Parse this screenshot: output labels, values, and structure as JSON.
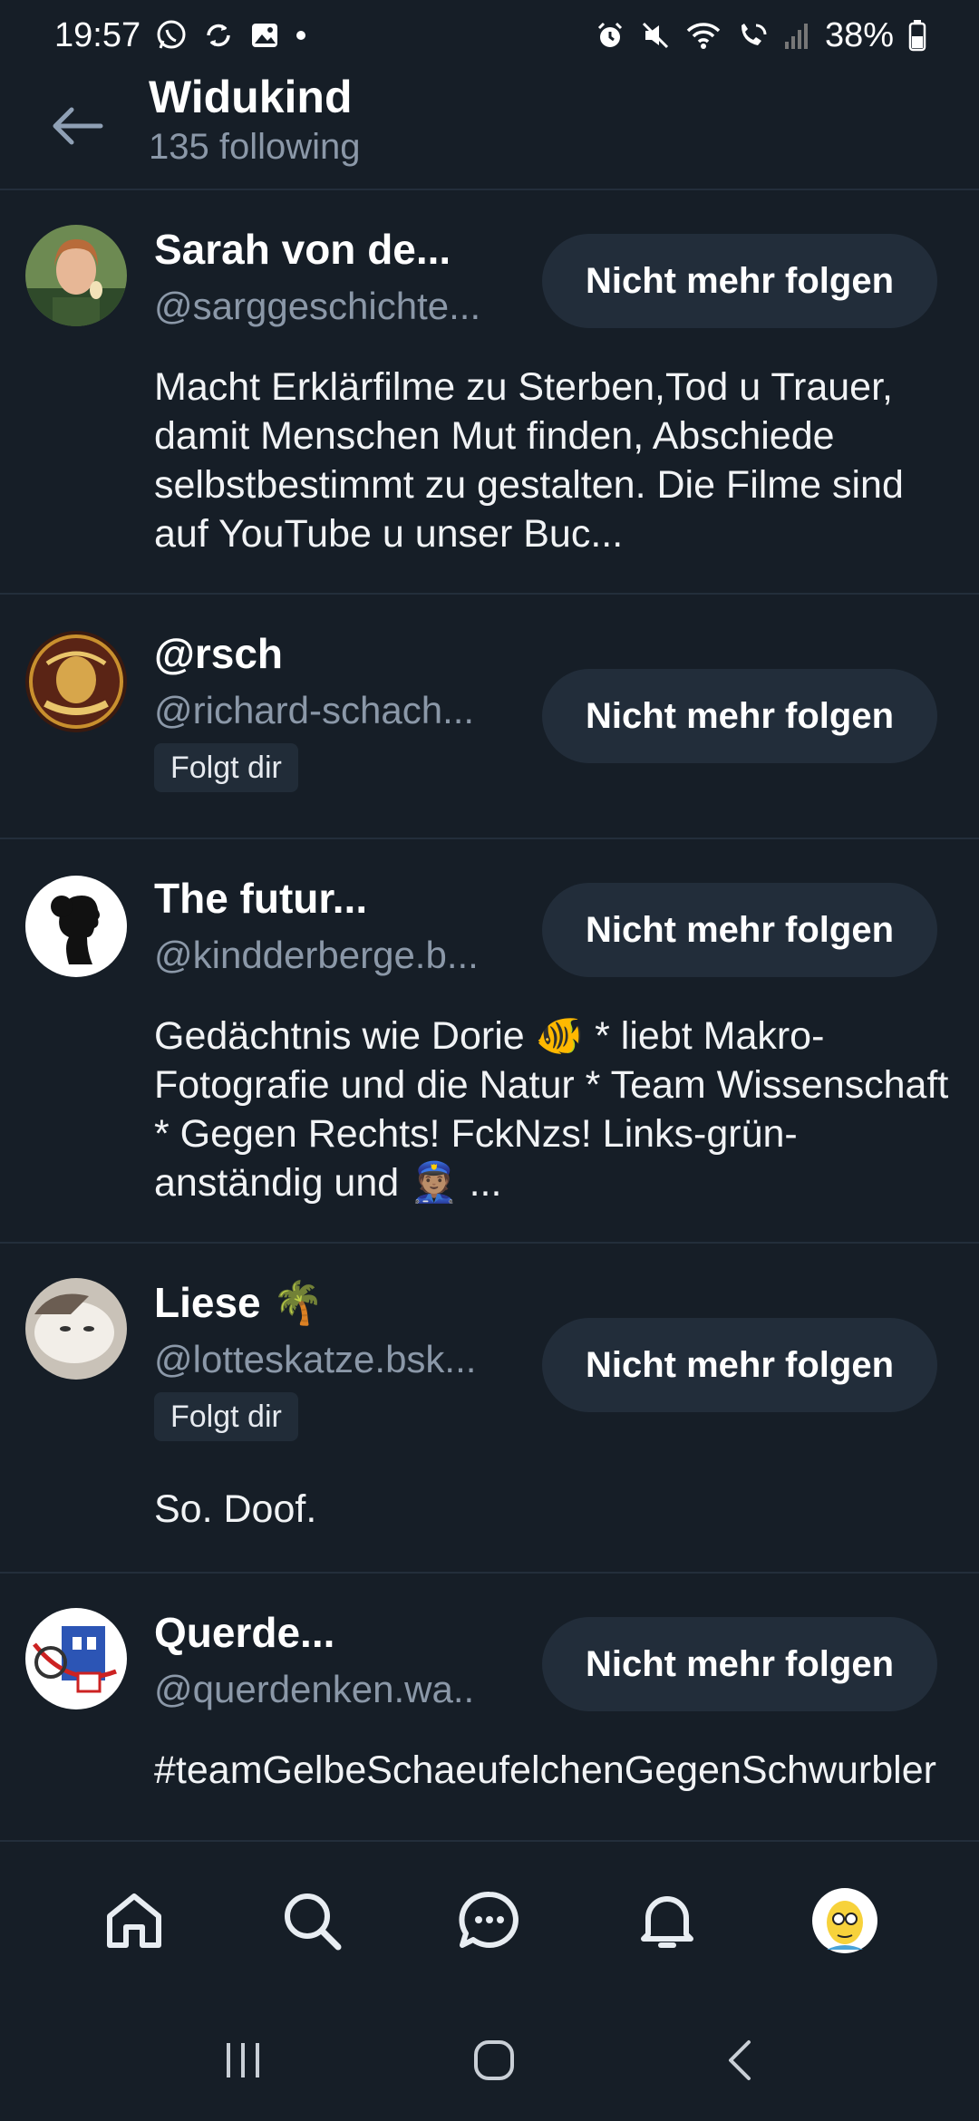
{
  "status_bar": {
    "time": "19:57",
    "battery": "38%",
    "icons_left": [
      "whatsapp-icon",
      "sync-icon",
      "gallery-icon",
      "dot-icon"
    ],
    "icons_right": [
      "alarm-icon",
      "mute-icon",
      "wifi-icon",
      "wifi-calling-icon",
      "signal-icon",
      "battery-icon"
    ]
  },
  "header": {
    "title": "Widukind",
    "subtitle": "135 following",
    "back_icon": "arrow-left-icon"
  },
  "unfollow_label": "Nicht mehr folgen",
  "follows_you_label": "Folgt dir",
  "rows": [
    {
      "name": "Sarah von de...",
      "handle": "@sarggeschichte...",
      "follows_you": false,
      "bio": "Macht Erklärfilme zu Sterben,Tod u Trauer, damit Menschen Mut finden, Abschiede selbstbestimmt zu gestalten. Die Filme sind auf YouTube u unser Buc..."
    },
    {
      "name": "@rsch",
      "handle": "@richard-schach...",
      "follows_you": true,
      "bio": ""
    },
    {
      "name": "The futur...",
      "handle": "@kindderberge.b...",
      "follows_you": false,
      "bio": "Gedächtnis wie Dorie 🐠 * liebt Makro-Fotografie und die Natur * Team Wissenschaft * Gegen Rechts! FckNzs! Links-grün-anständig und 👮🏽 ..."
    },
    {
      "name": "Liese 🌴",
      "handle": "@lotteskatze.bsk...",
      "follows_you": true,
      "bio": "So. Doof."
    },
    {
      "name": "Querde...",
      "handle": "@querdenken.wa..",
      "follows_you": false,
      "bio": "#teamGelbeSchaeufelchenGegenSchwurbler"
    }
  ],
  "bottom_nav": [
    "home-icon",
    "search-icon",
    "chat-icon",
    "bell-icon",
    "profile-avatar"
  ],
  "system_nav": [
    "recents-icon",
    "home-circle-icon",
    "back-chevron-icon"
  ],
  "colors": {
    "background": "#161e27",
    "divider": "#232e3b",
    "button_bg": "#222d3a",
    "muted_text": "#8b98a8"
  }
}
